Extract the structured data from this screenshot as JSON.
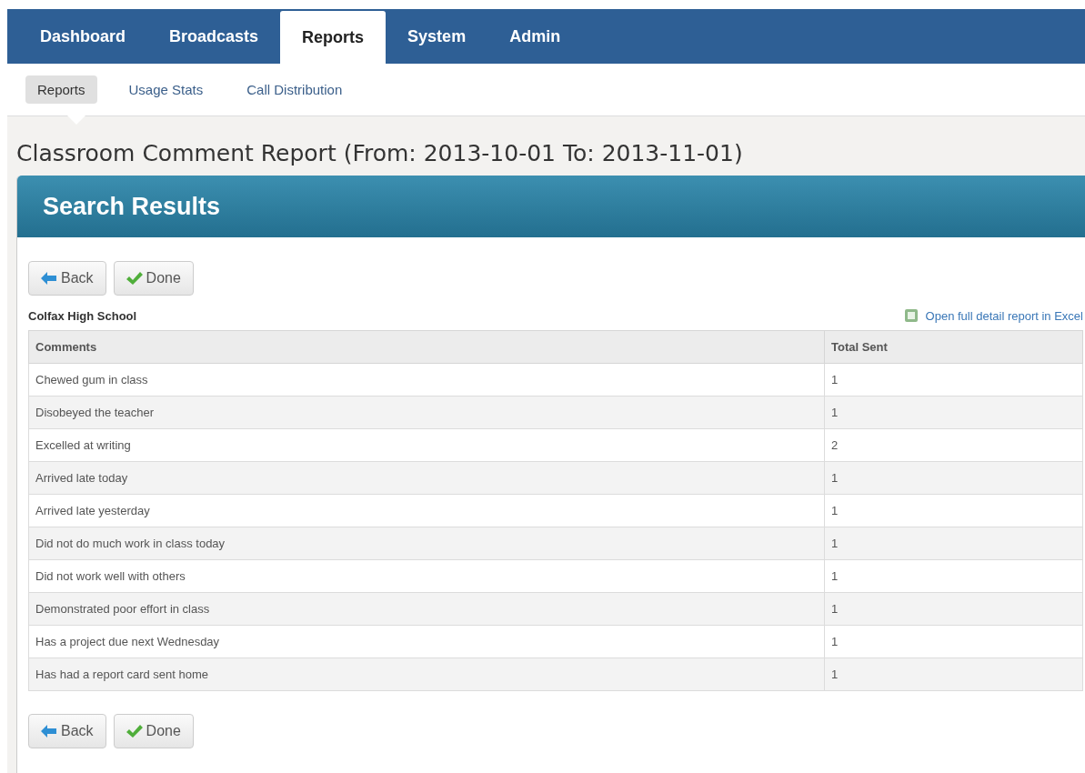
{
  "main_nav": [
    {
      "label": "Dashboard",
      "selected": false
    },
    {
      "label": "Broadcasts",
      "selected": false
    },
    {
      "label": "Reports",
      "selected": true
    },
    {
      "label": "System",
      "selected": false
    },
    {
      "label": "Admin",
      "selected": false
    }
  ],
  "sub_nav": [
    {
      "label": "Reports",
      "selected": true
    },
    {
      "label": "Usage Stats",
      "selected": false
    },
    {
      "label": "Call Distribution",
      "selected": false
    }
  ],
  "page_title": "Classroom Comment Report (From: 2013-10-01 To: 2013-11-01)",
  "panel": {
    "title": "Search Results",
    "top_buttons": [
      {
        "kind": "back",
        "label": "Back"
      },
      {
        "kind": "done",
        "label": "Done"
      }
    ],
    "school": "Colfax High School",
    "excel_link": "Open full detail report in Excel",
    "table": {
      "columns": [
        "Comments",
        "Total Sent"
      ],
      "rows": [
        [
          "Chewed gum in class",
          "1"
        ],
        [
          "Disobeyed the teacher",
          "1"
        ],
        [
          "Excelled at writing",
          "2"
        ],
        [
          "Arrived late today",
          "1"
        ],
        [
          "Arrived late yesterday",
          "1"
        ],
        [
          "Did not do much work in class today",
          "1"
        ],
        [
          "Did not work well with others",
          "1"
        ],
        [
          "Demonstrated poor effort in class",
          "1"
        ],
        [
          "Has a project due next Wednesday",
          "1"
        ],
        [
          "Has had a report card sent home",
          "1"
        ]
      ]
    },
    "bottom_buttons": [
      {
        "kind": "back",
        "label": "Back"
      },
      {
        "kind": "done",
        "label": "Done"
      }
    ]
  }
}
